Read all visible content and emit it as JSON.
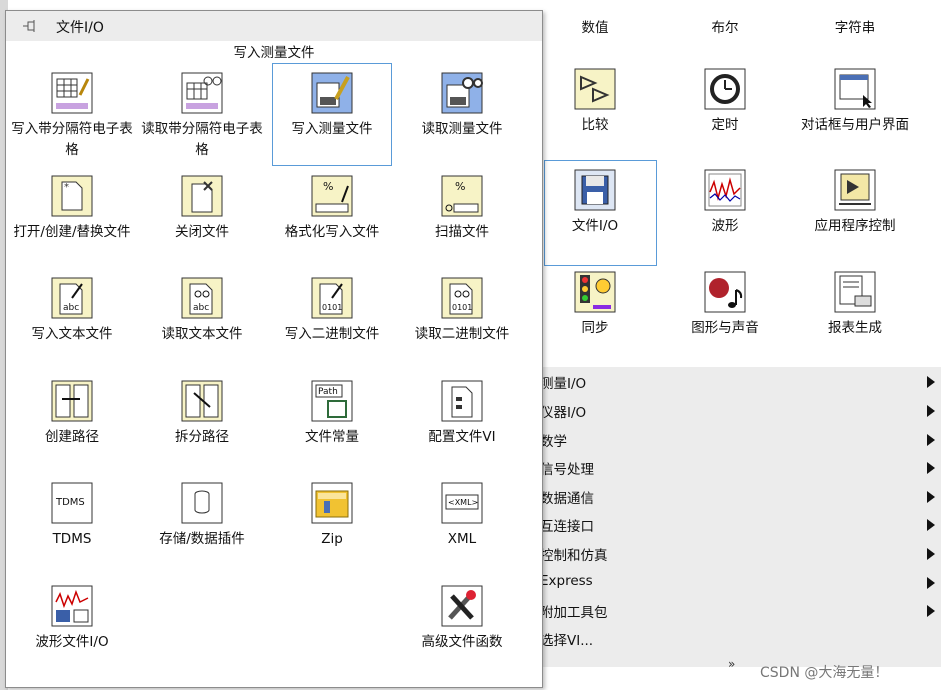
{
  "background_palette": {
    "row1": [
      "数值",
      "布尔",
      "字符串"
    ],
    "row2": [
      "比较",
      "定时",
      "对话框与用户界面"
    ],
    "row3": [
      "文件I/O",
      "波形",
      "应用程序控制"
    ],
    "row4": [
      "同步",
      "图形与声音",
      "报表生成"
    ],
    "menu": [
      {
        "label": "测量I/O",
        "has_submenu": true
      },
      {
        "label": "仪器I/O",
        "has_submenu": true
      },
      {
        "label": "数学",
        "has_submenu": true
      },
      {
        "label": "信号处理",
        "has_submenu": true
      },
      {
        "label": "数据通信",
        "has_submenu": true
      },
      {
        "label": "互连接口",
        "has_submenu": true
      },
      {
        "label": "控制和仿真",
        "has_submenu": true
      },
      {
        "label": "Express",
        "has_submenu": true
      },
      {
        "label": "附加工具包",
        "has_submenu": true
      },
      {
        "label": "选择VI...",
        "has_submenu": false
      }
    ],
    "expand_glyph": "»",
    "watermark": "CSDN @大海无量！"
  },
  "popup": {
    "title": "文件I/O",
    "tooltip": "写入测量文件",
    "items": [
      {
        "label": "写入带分隔符电子表格",
        "icon": "spreadsheet-write-icon"
      },
      {
        "label": "读取带分隔符电子表格",
        "icon": "spreadsheet-read-icon"
      },
      {
        "label": "写入测量文件",
        "icon": "write-measurement-file-icon"
      },
      {
        "label": "读取测量文件",
        "icon": "read-measurement-file-icon"
      },
      {
        "label": "打开/创建/替换文件",
        "icon": "open-create-replace-file-icon"
      },
      {
        "label": "关闭文件",
        "icon": "close-file-icon"
      },
      {
        "label": "格式化写入文件",
        "icon": "format-into-file-icon"
      },
      {
        "label": "扫描文件",
        "icon": "scan-from-file-icon"
      },
      {
        "label": "写入文本文件",
        "icon": "write-text-file-icon"
      },
      {
        "label": "读取文本文件",
        "icon": "read-text-file-icon"
      },
      {
        "label": "写入二进制文件",
        "icon": "write-binary-file-icon"
      },
      {
        "label": "读取二进制文件",
        "icon": "read-binary-file-icon"
      },
      {
        "label": "创建路径",
        "icon": "build-path-icon"
      },
      {
        "label": "拆分路径",
        "icon": "strip-path-icon"
      },
      {
        "label": "文件常量",
        "icon": "file-constants-icon"
      },
      {
        "label": "配置文件VI",
        "icon": "config-file-vi-icon"
      },
      {
        "label": "TDMS",
        "icon": "tdms-icon"
      },
      {
        "label": "存储/数据插件",
        "icon": "storage-dataplugin-icon"
      },
      {
        "label": "Zip",
        "icon": "zip-icon"
      },
      {
        "label": "XML",
        "icon": "xml-icon"
      },
      {
        "label": "波形文件I/O",
        "icon": "waveform-file-io-icon"
      },
      {
        "label": "高级文件函数",
        "icon": "advanced-file-functions-icon"
      }
    ]
  }
}
